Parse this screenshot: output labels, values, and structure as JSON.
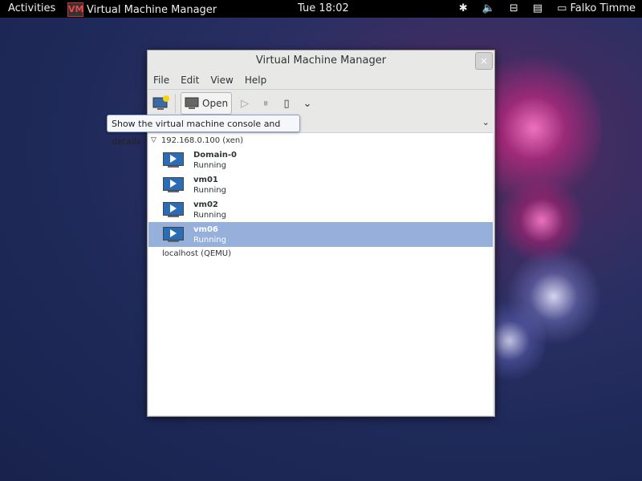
{
  "topbar": {
    "activities": "Activities",
    "app_title": "Virtual Machine Manager",
    "app_icon": "VM",
    "clock": "Tue 18:02",
    "user": "Falko Timme",
    "tray_icons": [
      "accessibility-icon",
      "volume-icon",
      "network-icon",
      "battery-icon",
      "user-icon"
    ]
  },
  "window": {
    "title": "Virtual Machine Manager",
    "close": "×",
    "menu": [
      "File",
      "Edit",
      "View",
      "Help"
    ],
    "toolbar": {
      "open_label": "Open",
      "run_icon": "▷",
      "pause_icon": "⏸",
      "shutdown_icon": "▯",
      "dropdown_icon": "⌄"
    },
    "filter_chevron": "⌄",
    "tooltip": "Show the virtual machine console and details",
    "connections": [
      {
        "name": "192.168.0.100 (xen)",
        "expanded": true,
        "vms": [
          {
            "name": "Domain-0",
            "status": "Running"
          },
          {
            "name": "vm01",
            "status": "Running"
          },
          {
            "name": "vm02",
            "status": "Running"
          },
          {
            "name": "vm06",
            "status": "Running",
            "selected": true
          }
        ]
      },
      {
        "name": "localhost (QEMU)",
        "expanded": false,
        "vms": []
      }
    ]
  }
}
